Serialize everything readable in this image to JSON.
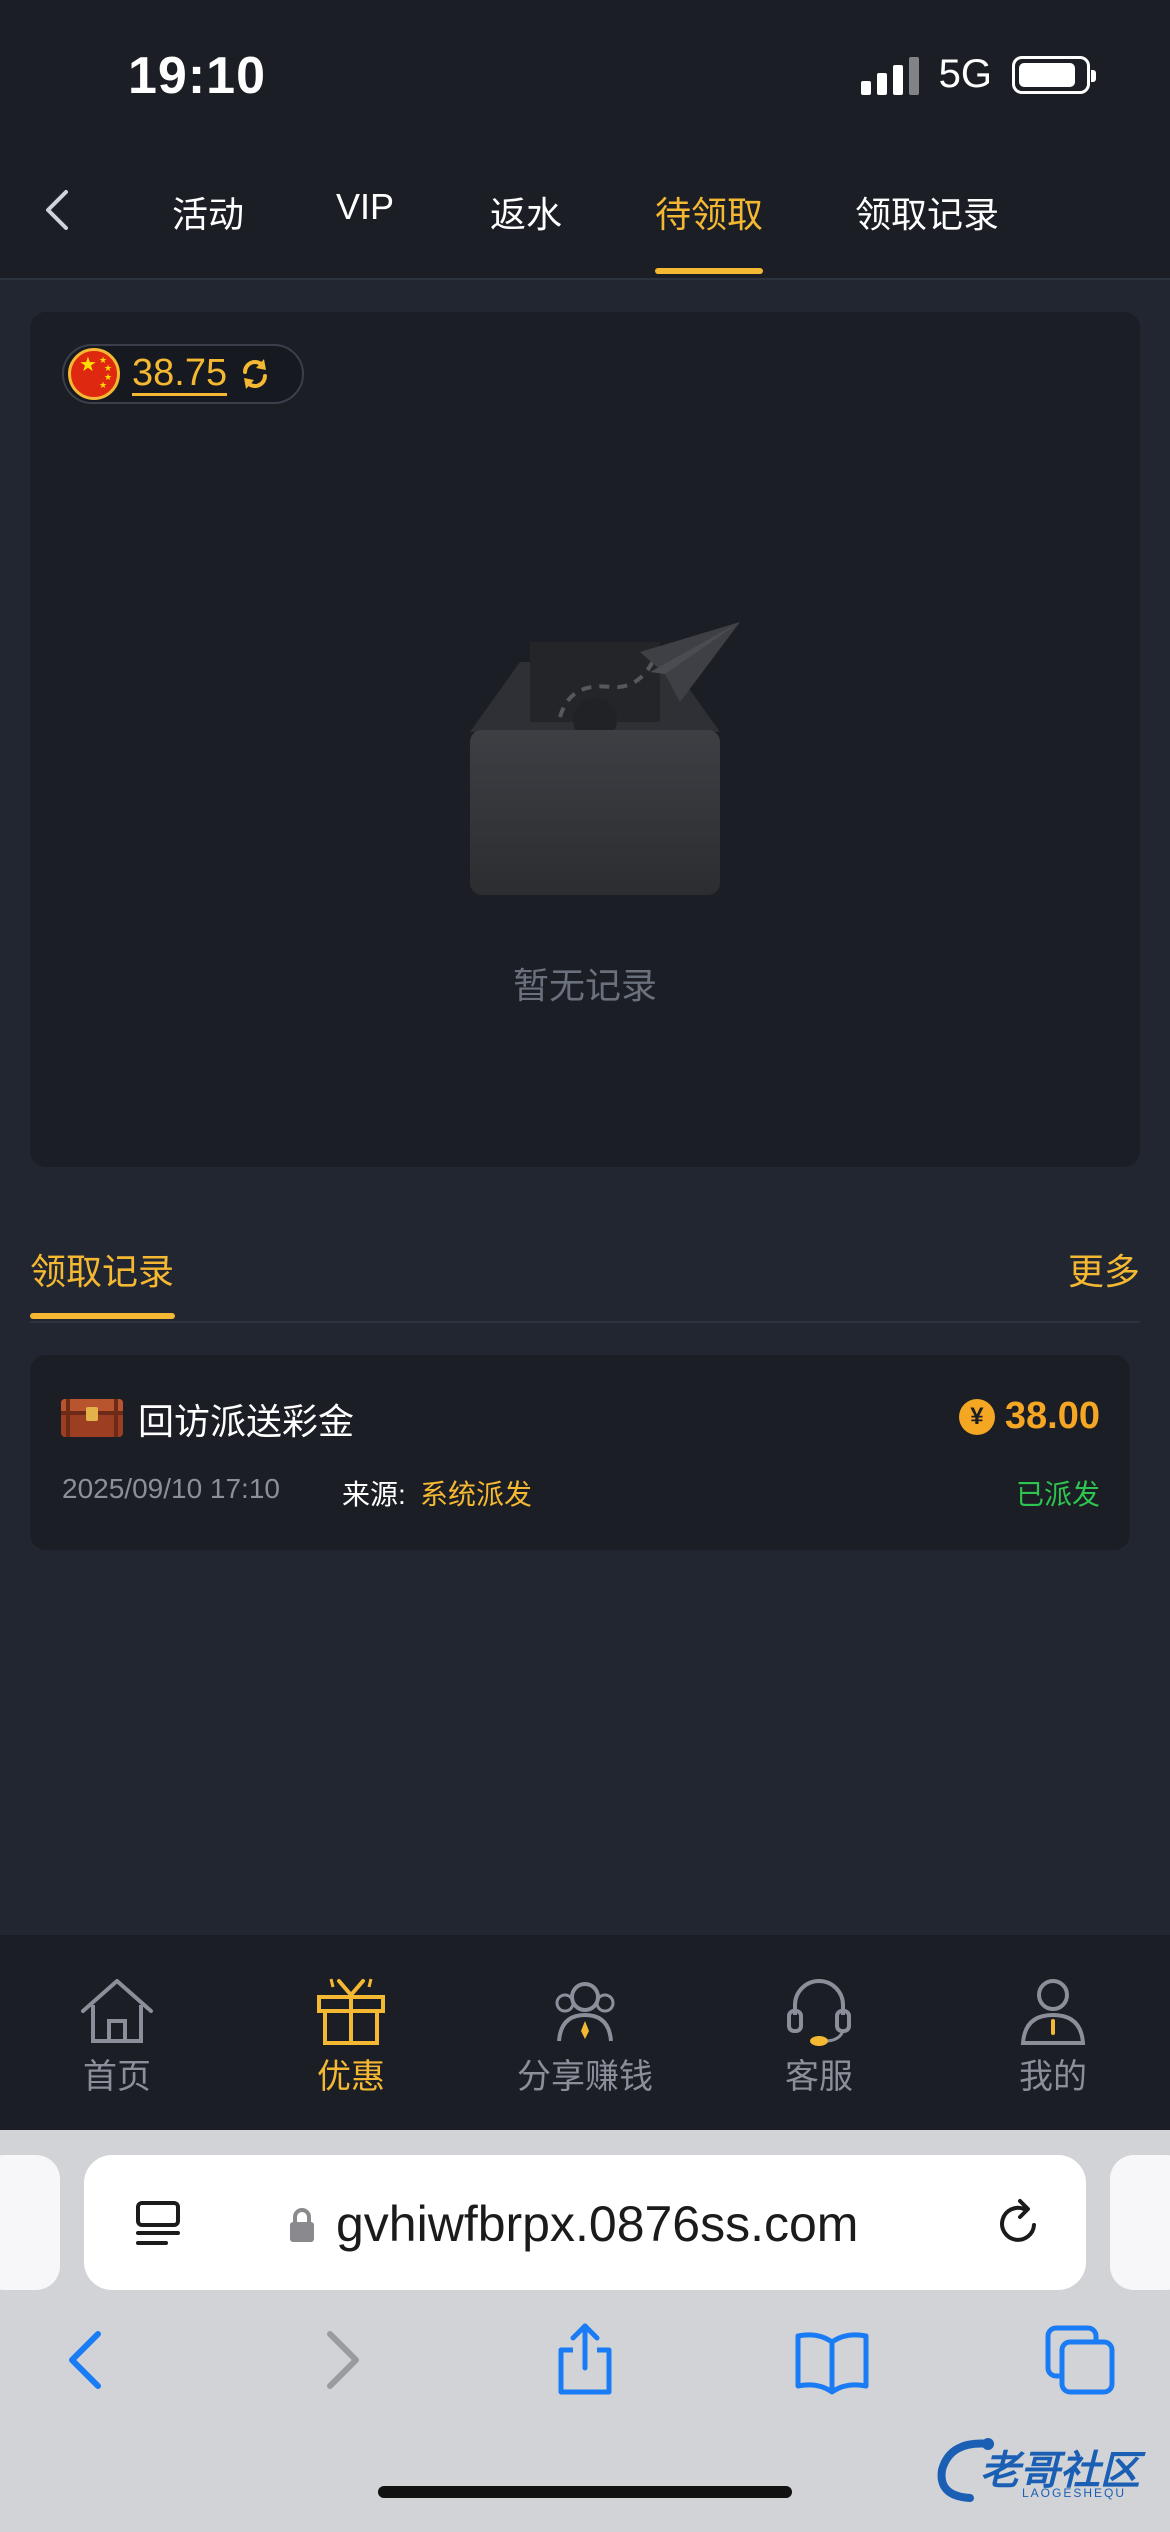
{
  "status_bar": {
    "time": "19:10",
    "network": "5G"
  },
  "top_nav": {
    "tabs": [
      {
        "label": "活动"
      },
      {
        "label": "VIP"
      },
      {
        "label": "返水"
      },
      {
        "label": "待领取",
        "active": true
      },
      {
        "label": "领取记录"
      }
    ]
  },
  "balance": {
    "value": "38.75"
  },
  "empty_state": {
    "text": "暂无记录"
  },
  "records_section": {
    "title": "领取记录",
    "more_label": "更多",
    "records": [
      {
        "title": "回访派送彩金",
        "amount": "38.00",
        "currency_symbol": "¥",
        "time": "2025/09/10 17:10",
        "source_label": "来源:",
        "source": "系统派发",
        "status": "已派发"
      }
    ]
  },
  "bottom_nav": {
    "items": [
      {
        "label": "首页",
        "icon": "home-icon"
      },
      {
        "label": "优惠",
        "icon": "gift-icon",
        "active": true
      },
      {
        "label": "分享赚钱",
        "icon": "share-people-icon"
      },
      {
        "label": "客服",
        "icon": "headset-icon"
      },
      {
        "label": "我的",
        "icon": "person-icon"
      }
    ]
  },
  "browser": {
    "url": "gvhiwfbrpx.0876ss.com"
  },
  "watermark": {
    "text": "老哥社区",
    "sub": "LAOGESHEQU"
  },
  "colors": {
    "accent": "#f5b832",
    "background": "#212630",
    "panel": "#1b1e25",
    "success": "#2ec44f"
  }
}
